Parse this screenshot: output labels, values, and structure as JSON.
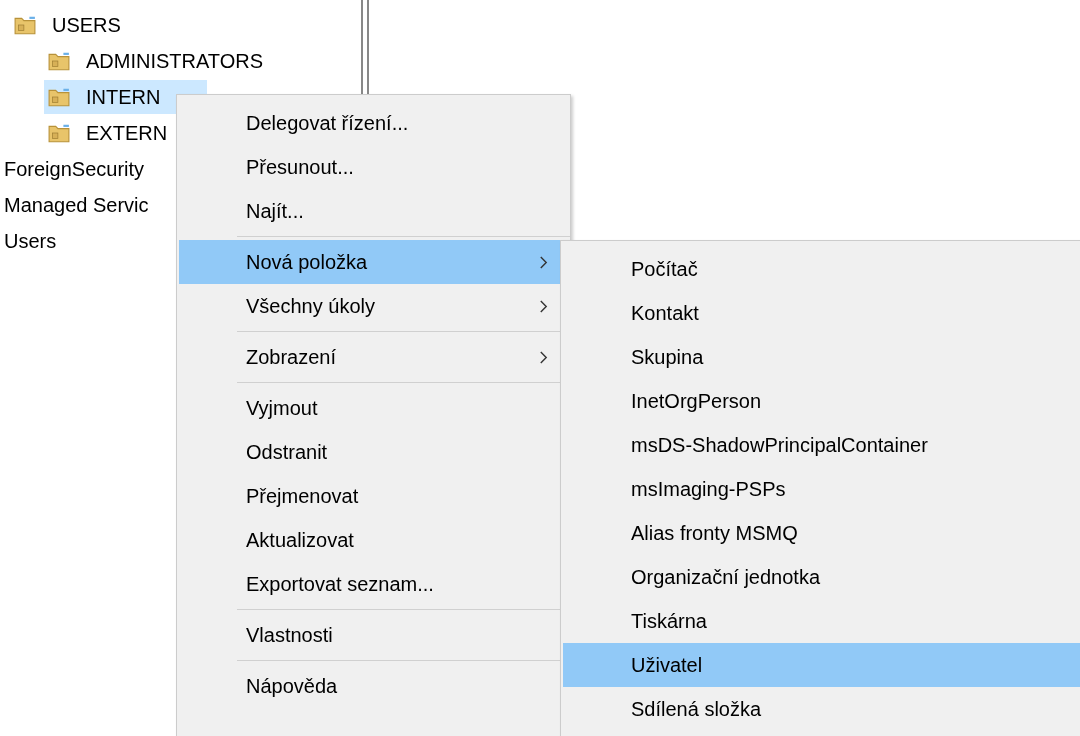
{
  "tree": {
    "items": [
      {
        "label": "USERS",
        "kind": "folder",
        "selected": false,
        "children": [
          {
            "label": "ADMINISTRATORS",
            "kind": "folder",
            "selected": false
          },
          {
            "label": "INTERN",
            "kind": "folder",
            "selected": true
          },
          {
            "label": "EXTERN",
            "kind": "folder",
            "selected": false
          }
        ]
      },
      {
        "label": "ForeignSecurity",
        "kind": "plain",
        "selected": false
      },
      {
        "label": "Managed Servic",
        "kind": "plain",
        "selected": false
      },
      {
        "label": "Users",
        "kind": "plain",
        "selected": false
      }
    ]
  },
  "context_menu": {
    "groups": [
      {
        "items": [
          {
            "label": "Delegovat řízení...",
            "selected": false,
            "submenu": false
          },
          {
            "label": "Přesunout...",
            "selected": false,
            "submenu": false
          },
          {
            "label": "Najít...",
            "selected": false,
            "submenu": false
          }
        ]
      },
      {
        "items": [
          {
            "label": "Nová položka",
            "selected": true,
            "submenu": true
          },
          {
            "label": "Všechny úkoly",
            "selected": false,
            "submenu": true
          }
        ]
      },
      {
        "items": [
          {
            "label": "Zobrazení",
            "selected": false,
            "submenu": true
          }
        ]
      },
      {
        "items": [
          {
            "label": "Vyjmout",
            "selected": false,
            "submenu": false
          },
          {
            "label": "Odstranit",
            "selected": false,
            "submenu": false
          },
          {
            "label": "Přejmenovat",
            "selected": false,
            "submenu": false
          },
          {
            "label": "Aktualizovat",
            "selected": false,
            "submenu": false
          },
          {
            "label": "Exportovat seznam...",
            "selected": false,
            "submenu": false
          }
        ]
      },
      {
        "items": [
          {
            "label": "Vlastnosti",
            "selected": false,
            "submenu": false
          }
        ]
      },
      {
        "items": [
          {
            "label": "Nápověda",
            "selected": false,
            "submenu": false
          }
        ]
      }
    ]
  },
  "submenu": {
    "items": [
      {
        "label": "Počítač",
        "selected": false
      },
      {
        "label": "Kontakt",
        "selected": false
      },
      {
        "label": "Skupina",
        "selected": false
      },
      {
        "label": "InetOrgPerson",
        "selected": false
      },
      {
        "label": "msDS-ShadowPrincipalContainer",
        "selected": false
      },
      {
        "label": "msImaging-PSPs",
        "selected": false
      },
      {
        "label": "Alias fronty MSMQ",
        "selected": false
      },
      {
        "label": "Organizační jednotka",
        "selected": false
      },
      {
        "label": "Tiskárna",
        "selected": false
      },
      {
        "label": "Uživatel",
        "selected": true
      },
      {
        "label": "Sdílená složka",
        "selected": false
      }
    ]
  }
}
